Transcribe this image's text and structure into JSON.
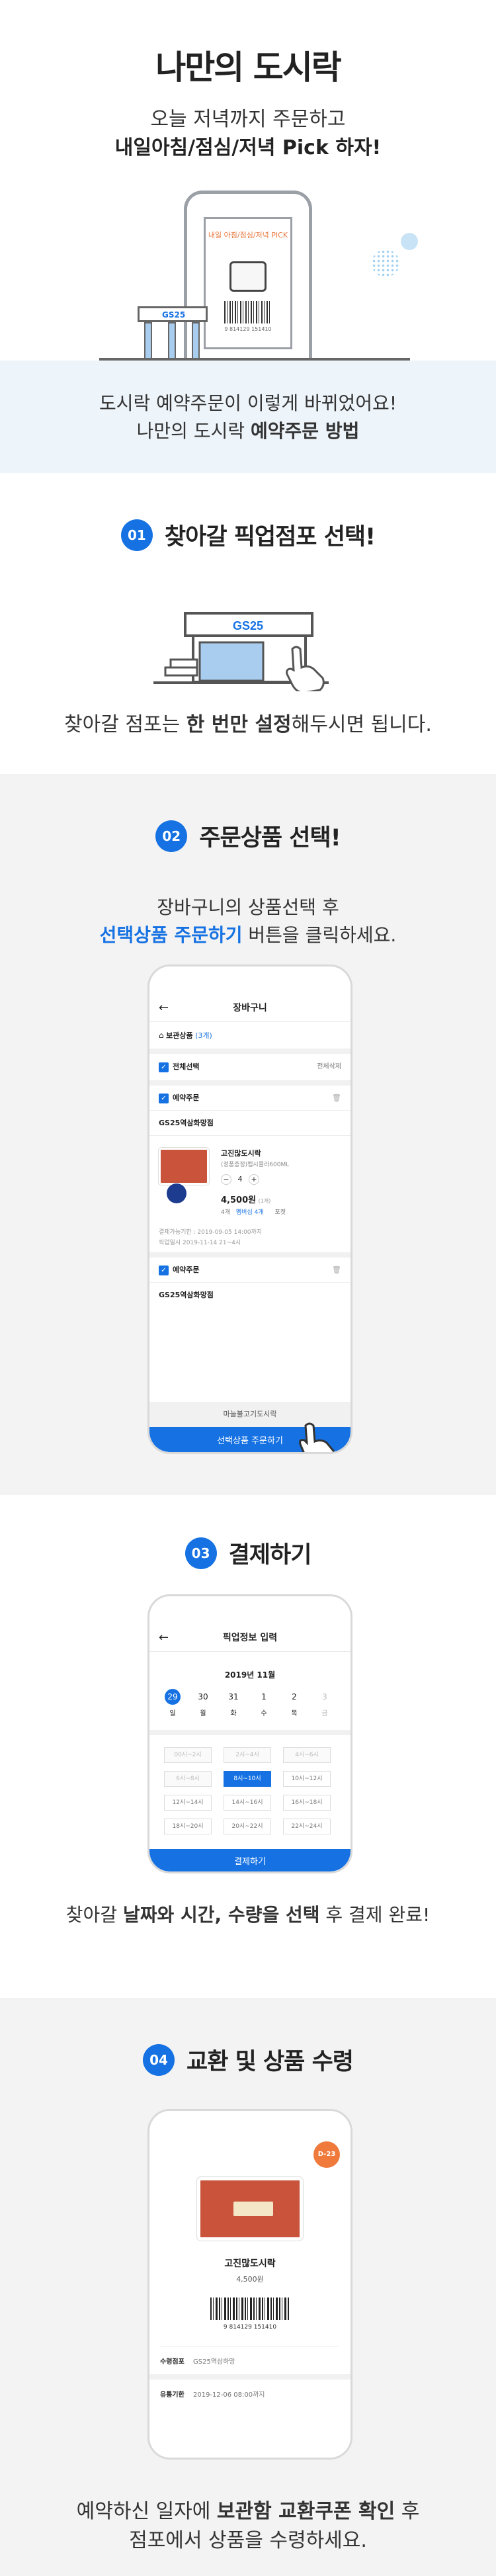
{
  "hero": {
    "title": "나만의 도시락",
    "subtitle_line1": "오늘 저녁까지 주문하고",
    "subtitle_line2": "내일아침/점심/저녁 Pick 하자!",
    "illus_card_text": "내일 아침/점심/저녁 PICK",
    "illus_store_logo": "GS25",
    "illus_barcode_number": "9 814129 151410"
  },
  "intro": {
    "line1": "도시락 예약주문이 이렇게 바뀌었어요!",
    "line2_prefix": "나만의 도시락 ",
    "line2_bold": "예약주문 방법"
  },
  "step1": {
    "number": "01",
    "title": "찾아갈 픽업점포 선택!",
    "store_logo": "GS25",
    "desc_prefix": "찾아갈 점포는 ",
    "desc_bold": "한 번만 설정",
    "desc_suffix": "해두시면 됩니다."
  },
  "step2": {
    "number": "02",
    "title": "주문상품 선택!",
    "line1": "장바구니의 상품선택 후",
    "line2_blue": "선택상품 주문하기",
    "line2_suffix": " 버튼을 클릭하세요.",
    "screen": {
      "header_title": "장바구니",
      "back_icon": "←",
      "cart_label": "보관상품",
      "cart_count": "(3개)",
      "select_all": "전체선택",
      "delete_all": "전체삭제",
      "group1_label": "예약주문",
      "store1": "GS25역삼화망점",
      "product_name": "고진많도시락",
      "product_option": "(정품증정)펩시콜라600ML",
      "quantity": "4",
      "price": "4,500원",
      "price_unit": "(1개)",
      "coupon_count": "4개",
      "coupon_label": "멤버십 4개",
      "coupon_sub": "포켓",
      "deadline": "결제가능기한 : 2019-09-05 14:00까지",
      "pickup_date": "픽업일시 2019-11-14 21~4시",
      "group2_label": "예약주문",
      "store2": "GS25역삼화망점",
      "bottom_item": "마늘불고기도시락",
      "cta_label": "선택상품 주문하기"
    }
  },
  "step3": {
    "number": "03",
    "title": "결제하기",
    "caption_prefix": "찾아갈 ",
    "caption_bold": "날짜와 시간, 수량을 선택",
    "caption_suffix": " 후 결제 완료!",
    "screen": {
      "header_title": "픽업정보 입력",
      "back_icon": "←",
      "month": "2019년 11월",
      "dates": [
        {
          "day": "29",
          "weekday": "일"
        },
        {
          "day": "30",
          "weekday": "월"
        },
        {
          "day": "31",
          "weekday": "화"
        },
        {
          "day": "1",
          "weekday": "수"
        },
        {
          "day": "2",
          "weekday": "목"
        },
        {
          "day": "3",
          "weekday": "금"
        }
      ],
      "time_slots": [
        [
          "00시~2시",
          "2시~4시",
          "4시~6시"
        ],
        [
          "6시~8시",
          "8시~10시",
          "10시~12시"
        ],
        [
          "12시~14시",
          "14시~16시",
          "16시~18시"
        ],
        [
          "18시~20시",
          "20시~22시",
          "22시~24시"
        ]
      ],
      "selected_slot": "8시~10시",
      "cta_label": "결제하기"
    }
  },
  "step4": {
    "number": "04",
    "title": "교환 및 상품 수령",
    "footer1_prefix": "예약하신 일자에 ",
    "footer1_bold": "보관함 교환쿠폰 확인",
    "footer1_suffix": " 후",
    "footer2": "점포에서 상품을 수령하세요.",
    "screen": {
      "dday_badge": "D-23",
      "product_name": "고진많도시락",
      "price": "4,500원",
      "barcode_number": "9 814129 151410",
      "pickup_store_label": "수령점포",
      "pickup_store_value": "GS25역삼하망",
      "expiry_label": "유통기한",
      "expiry_value": "2019-12-06 08:00까지"
    }
  },
  "colors": {
    "accent_blue": "#1672e3",
    "light_blue_bg": "#edf4fa",
    "gray_bg": "#f3f3f3"
  }
}
